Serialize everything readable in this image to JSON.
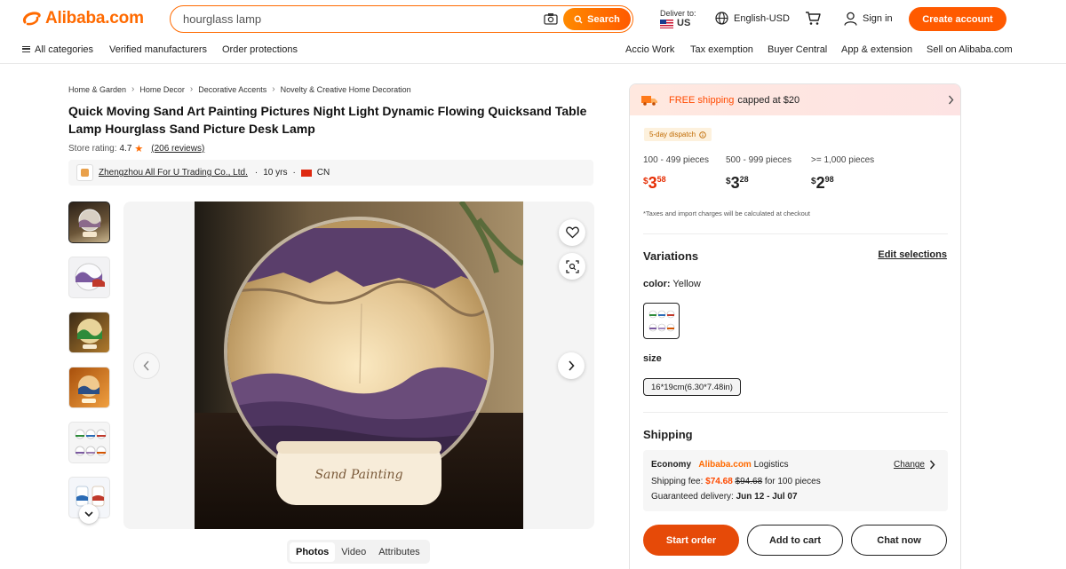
{
  "header": {
    "logo": "Alibaba.com",
    "search_value": "hourglass lamp",
    "search_button": "Search",
    "deliver_label": "Deliver to:",
    "deliver_country": "US",
    "language": "English-USD",
    "sign_in": "Sign in",
    "create_account": "Create account"
  },
  "subnav": {
    "left": [
      "All categories",
      "Verified manufacturers",
      "Order protections"
    ],
    "right": [
      "Accio Work",
      "Tax exemption",
      "Buyer Central",
      "App & extension",
      "Sell on Alibaba.com"
    ]
  },
  "breadcrumb": [
    "Home & Garden",
    "Home Decor",
    "Decorative Accents",
    "Novelty & Creative Home Decoration"
  ],
  "product": {
    "title": "Quick Moving Sand Art Painting Pictures Night Light Dynamic Flowing Quicksand Table Lamp Hourglass Sand Picture Desk Lamp",
    "store_rating_label": "Store rating:",
    "store_rating_value": "4.7",
    "reviews": "(206 reviews)",
    "supplier_name": "Zhengzhou All For U Trading Co., Ltd.",
    "years": "10 yrs",
    "country": "CN",
    "image_text": "Sand Painting"
  },
  "media_tabs": [
    "Photos",
    "Video",
    "Attributes"
  ],
  "panel": {
    "shipping_banner_free": "FREE shipping",
    "shipping_banner_rest": "capped at $20",
    "dispatch": "5-day dispatch",
    "tiers": [
      {
        "range": "100 - 499 pieces",
        "cur": "$",
        "whole": "3",
        "cents": "58"
      },
      {
        "range": "500 - 999 pieces",
        "cur": "$",
        "whole": "3",
        "cents": "28"
      },
      {
        "range": ">= 1,000 pieces",
        "cur": "$",
        "whole": "2",
        "cents": "98"
      }
    ],
    "tax_note": "*Taxes and import charges will be calculated at checkout",
    "variations_title": "Variations",
    "edit_selections": "Edit selections",
    "color_label": "color:",
    "color_value": "Yellow",
    "size_label": "size",
    "size_value": "16*19cm(6.30*7.48in)",
    "shipping_title": "Shipping",
    "economy": "Economy",
    "logistics_brand": "Alibaba.com",
    "logistics": "Logistics",
    "change": "Change",
    "fee_label": "Shipping fee:",
    "fee": "$74.68",
    "fee_old": "$94.68",
    "fee_qty": "for 100 pieces",
    "guaranteed_label": "Guaranteed delivery:",
    "guaranteed_dates": "Jun 12 - Jul 07",
    "start_order": "Start order",
    "add_to_cart": "Add to cart",
    "chat_now": "Chat now"
  },
  "colors": {
    "brand": "#ff6a00",
    "primary_button": "#e64a08",
    "price_red": "#e62e04"
  }
}
